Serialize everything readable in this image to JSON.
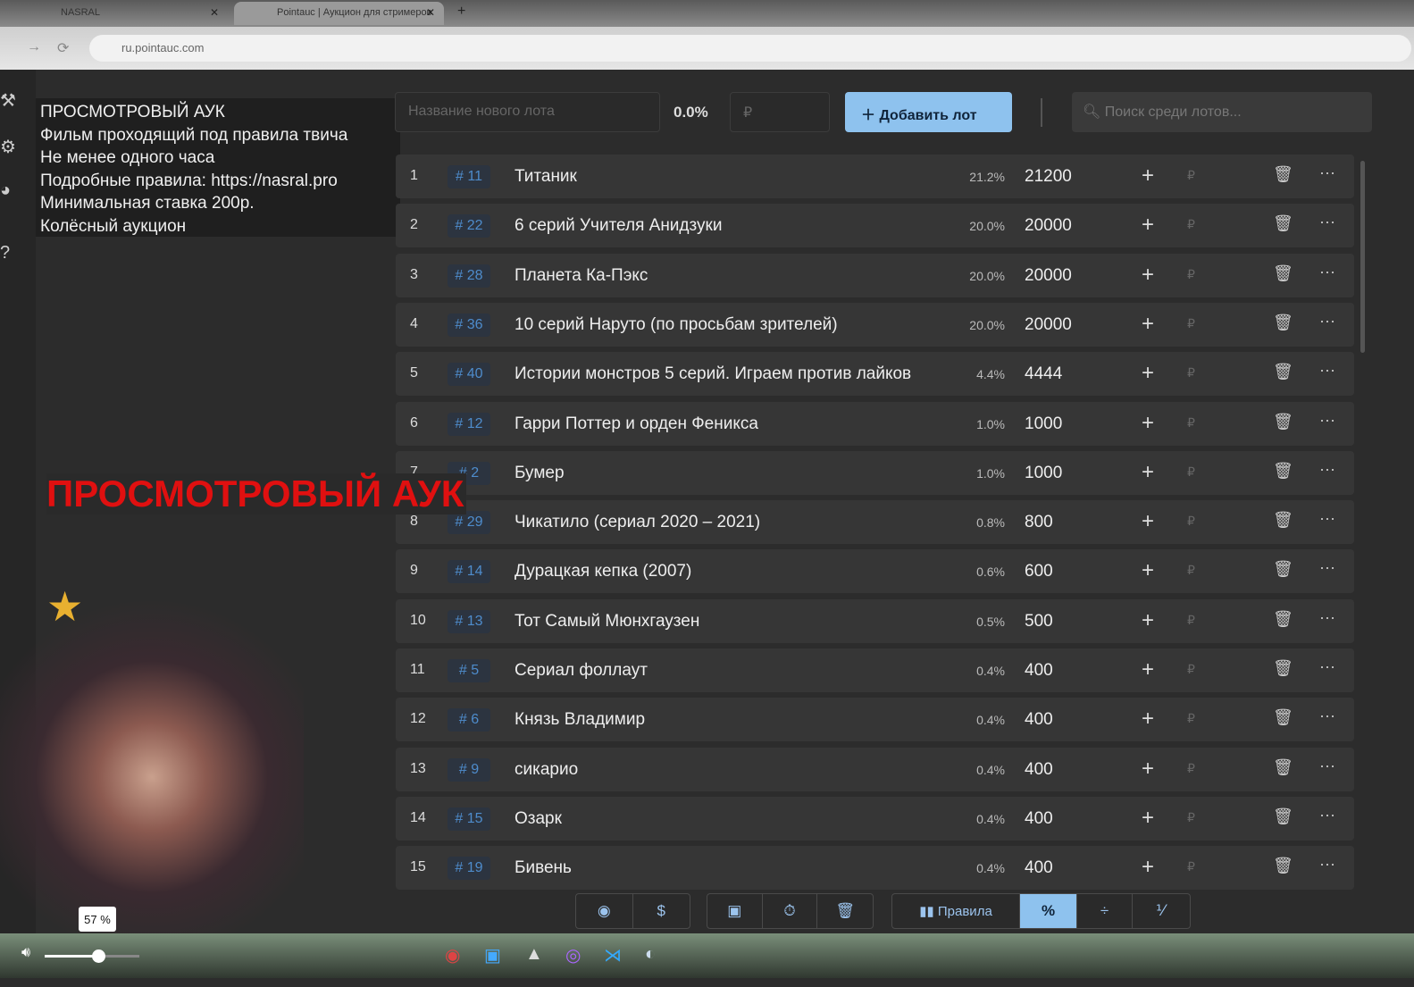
{
  "browser": {
    "tabs": [
      {
        "title": "NASRAL"
      },
      {
        "title": "Pointauc | Аукцион для стримеров"
      }
    ],
    "url": "ru.pointauc.com"
  },
  "overlay": {
    "lines": [
      "ПРОСМОТРОВЫЙ АУК",
      "Фильм проходящий под правила твича",
      "Не менее одного часа",
      "Подробные правила: https://nasral.pro",
      "Минимальная ставка 200р.",
      "Колёсный аукцион"
    ],
    "banner": "ПРОСМОТРОВЫЙ АУК"
  },
  "toolbar": {
    "new_lot_placeholder": "Название нового лота",
    "percent": "0.0%",
    "amount_placeholder": "₽",
    "add_label": "Добавить лот",
    "search_placeholder": "Поиск среди лотов..."
  },
  "lots": [
    {
      "n": "1",
      "id": "# 11",
      "name": "Титаник",
      "pct": "21.2%",
      "amount": "21200"
    },
    {
      "n": "2",
      "id": "# 22",
      "name": "6 серий Учителя Анидзуки",
      "pct": "20.0%",
      "amount": "20000"
    },
    {
      "n": "3",
      "id": "# 28",
      "name": "Планета Ка-Пэкс",
      "pct": "20.0%",
      "amount": "20000"
    },
    {
      "n": "4",
      "id": "# 36",
      "name": "10 серий Наруто (по просьбам зрителей)",
      "pct": "20.0%",
      "amount": "20000"
    },
    {
      "n": "5",
      "id": "# 40",
      "name": "Истории монстров 5 серий. Играем против лайков",
      "pct": "4.4%",
      "amount": "4444"
    },
    {
      "n": "6",
      "id": "# 12",
      "name": "Гарри Поттер и орден Феникса",
      "pct": "1.0%",
      "amount": "1000"
    },
    {
      "n": "7",
      "id": "# 2",
      "name": "Бумер",
      "pct": "1.0%",
      "amount": "1000"
    },
    {
      "n": "8",
      "id": "# 29",
      "name": "Чикатило (сериал 2020 – 2021)",
      "pct": "0.8%",
      "amount": "800"
    },
    {
      "n": "9",
      "id": "# 14",
      "name": "Дурацкая кепка (2007)",
      "pct": "0.6%",
      "amount": "600"
    },
    {
      "n": "10",
      "id": "# 13",
      "name": "Тот Самый Мюнхгаузен",
      "pct": "0.5%",
      "amount": "500"
    },
    {
      "n": "11",
      "id": "# 5",
      "name": "Сериал фоллаут",
      "pct": "0.4%",
      "amount": "400"
    },
    {
      "n": "12",
      "id": "# 6",
      "name": "Князь Владимир",
      "pct": "0.4%",
      "amount": "400"
    },
    {
      "n": "13",
      "id": "# 9",
      "name": "сикарио",
      "pct": "0.4%",
      "amount": "400"
    },
    {
      "n": "14",
      "id": "# 15",
      "name": "Озарк",
      "pct": "0.4%",
      "amount": "400"
    },
    {
      "n": "15",
      "id": "# 19",
      "name": "Бивень",
      "pct": "0.4%",
      "amount": "400"
    }
  ],
  "bottom": {
    "rules_label": "Правила",
    "percent_icon": "%"
  },
  "player": {
    "volume": "57 %",
    "volume_fraction": 0.57
  },
  "colors": {
    "accent": "#8ec2ee",
    "id": "#4e8ccc",
    "banner": "#e01010"
  }
}
